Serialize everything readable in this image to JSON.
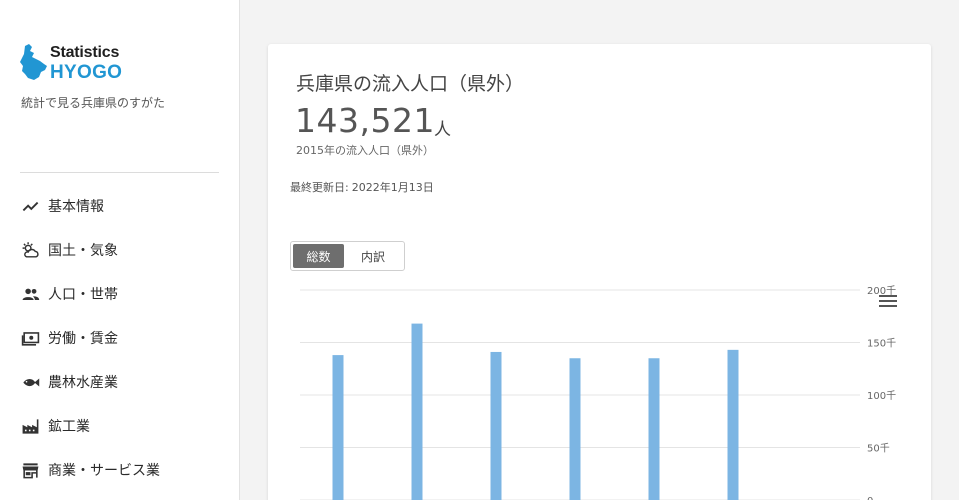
{
  "brand": {
    "line1": "Statistics",
    "line2": "HYOGO",
    "tagline": "統計で見る兵庫県のすがた",
    "logo_color": "#2196d3"
  },
  "nav": {
    "items": [
      {
        "label": "基本情報",
        "icon": "trending-line-icon"
      },
      {
        "label": "国土・気象",
        "icon": "weather-icon"
      },
      {
        "label": "人口・世帯",
        "icon": "people-icon"
      },
      {
        "label": "労働・賃金",
        "icon": "money-icon"
      },
      {
        "label": "農林水産業",
        "icon": "fish-icon"
      },
      {
        "label": "鉱工業",
        "icon": "factory-icon"
      },
      {
        "label": "商業・サービス業",
        "icon": "store-icon"
      }
    ]
  },
  "card": {
    "title": "兵庫県の流入人口（県外）",
    "value": "143,521",
    "unit": "人",
    "caption": "2015年の流入人口（県外）",
    "updated_label": "最終更新日:",
    "updated_date": "2022年1月13日",
    "toggle": {
      "active": "総数",
      "inactive": "内訳"
    }
  },
  "chart_data": {
    "type": "bar",
    "values": [
      138000,
      168000,
      141000,
      135000,
      135000,
      143000
    ],
    "y_ticks": [
      "200千",
      "150千",
      "100千",
      "50千",
      "0"
    ],
    "ylim": [
      0,
      200000
    ],
    "grid": true,
    "bar_color": "#7cb5e3"
  }
}
